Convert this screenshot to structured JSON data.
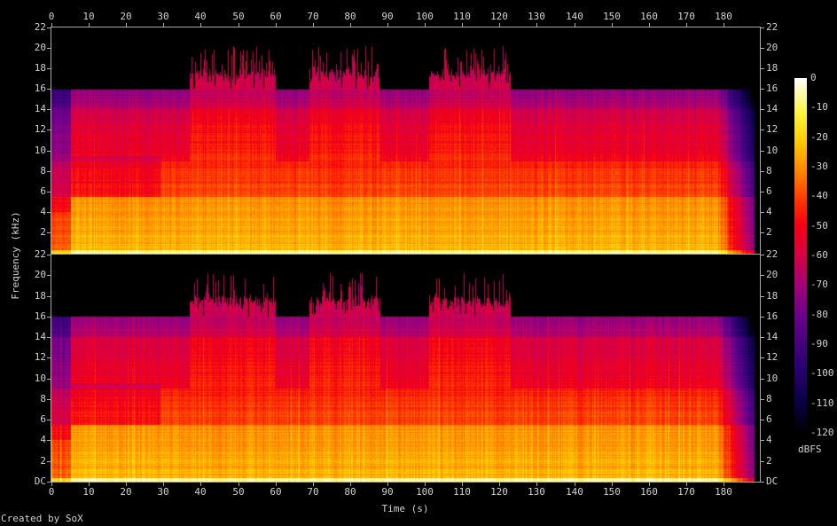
{
  "chart_data": {
    "type": "heatmap",
    "title": "",
    "xlabel": "Time (s)",
    "ylabel": "Frequency (kHz)",
    "colorbar_label": "dBFS",
    "footer": "Created by SoX",
    "channels": 2,
    "xlim": [
      0,
      188.3
    ],
    "ylim": [
      0,
      22
    ],
    "x_ticks": [
      "0",
      "10",
      "20",
      "30",
      "40",
      "50",
      "60",
      "70",
      "80",
      "90",
      "100",
      "110",
      "120",
      "130",
      "140",
      "150",
      "160",
      "170",
      "180"
    ],
    "y_ticks_top": [
      "2",
      "4",
      "6",
      "8",
      "10",
      "12",
      "14",
      "16",
      "18",
      "20",
      "22"
    ],
    "y_ticks_bottom": [
      "DC",
      "2",
      "4",
      "6",
      "8",
      "10",
      "12",
      "14",
      "16",
      "18",
      "20",
      "22"
    ],
    "colorbar_ticks": [
      "0",
      "-10",
      "-20",
      "-30",
      "-40",
      "-50",
      "-60",
      "-70",
      "-80",
      "-90",
      "-100",
      "-110",
      "-120"
    ],
    "colorbar_range": [
      -120,
      0
    ],
    "lowpass_cutoff_khz": 16,
    "high_frequency_bursts_s": [
      [
        37,
        60
      ],
      [
        69,
        88
      ],
      [
        101,
        123
      ]
    ],
    "quiet_intro_s": [
      0,
      5
    ],
    "section_change_s": 29
  }
}
